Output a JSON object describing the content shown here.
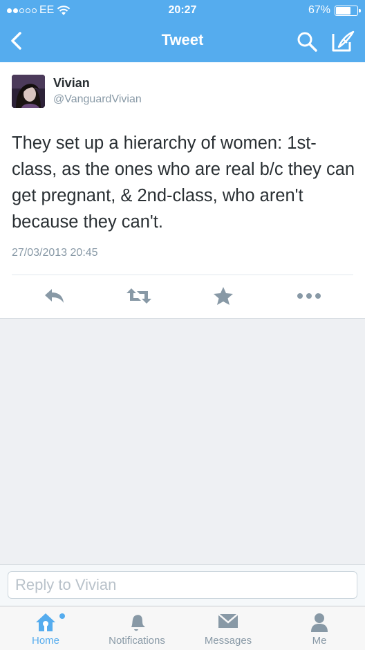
{
  "status_bar": {
    "carrier": "EE",
    "time": "20:27",
    "battery": "67%",
    "signal_bars_filled": 2,
    "signal_bars_total": 5
  },
  "nav": {
    "title": "Tweet",
    "back_icon": "chevron-left-icon",
    "search_icon": "search-icon",
    "compose_icon": "compose-icon"
  },
  "tweet": {
    "author_name": "Vivian",
    "author_handle": "@VanguardVivian",
    "text": "They set up a hierarchy of women: 1st-class, as the ones who are real b/c they can get pregnant, & 2nd-class, who aren't because they can't.",
    "timestamp": "27/03/2013 20:45"
  },
  "actions": [
    "reply-icon",
    "retweet-icon",
    "favorite-icon",
    "more-icon"
  ],
  "reply": {
    "placeholder": "Reply to Vivian"
  },
  "tabbar": {
    "tabs": [
      {
        "label": "Home",
        "icon": "home-icon",
        "active": true
      },
      {
        "label": "Notifications",
        "icon": "bell-icon",
        "active": false
      },
      {
        "label": "Messages",
        "icon": "envelope-icon",
        "active": false
      },
      {
        "label": "Me",
        "icon": "person-icon",
        "active": false
      }
    ]
  },
  "colors": {
    "brand": "#55acee",
    "text": "#292f33",
    "muted": "#8899a6",
    "icon_gray": "#8899a6"
  }
}
